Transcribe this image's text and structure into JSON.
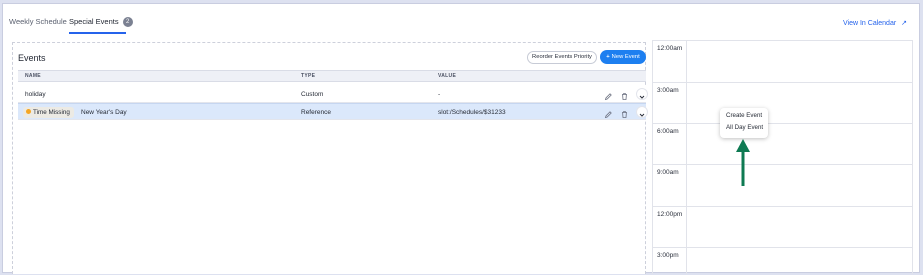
{
  "tabs": {
    "weekly_label": "Weekly Schedule",
    "special_label": "Special Events",
    "special_count": "2",
    "view_calendar": "View In Calendar",
    "view_calendar_icon": "arrow-up-right-icon"
  },
  "events": {
    "title": "Events",
    "reorder_label": "Reorder Events Priority",
    "new_event_label": "New Event",
    "columns": {
      "name": "NAME",
      "type": "TYPE",
      "value": "VALUE"
    },
    "rows": [
      {
        "name": "holiday",
        "type": "Custom",
        "value": "-",
        "selected": false
      },
      {
        "badge": "Time Missing",
        "name": "New Year's Day",
        "type": "Reference",
        "value": "slot:/Schedules/$31233",
        "selected": true
      }
    ]
  },
  "calendar": {
    "times": [
      "12:00am",
      "3:00am",
      "6:00am",
      "9:00am",
      "12:00pm",
      "3:00pm"
    ]
  },
  "context_menu": {
    "create_event": "Create Event",
    "all_day_event": "All Day Event"
  },
  "colors": {
    "accent": "#1d7ff0",
    "selected_row": "#dbe8fb",
    "badge_dot": "#f5a623",
    "annotation_arrow": "#0e7a52"
  }
}
